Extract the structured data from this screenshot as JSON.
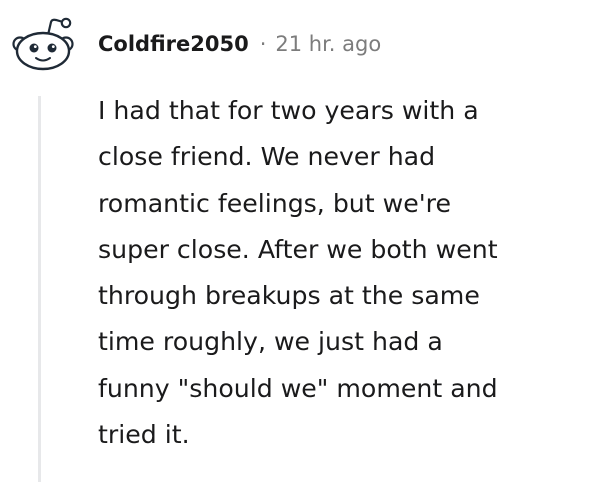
{
  "comment": {
    "author": "Coldfire2050",
    "separator": "·",
    "timestamp": "21 hr. ago",
    "avatar_icon": "reddit-snoo-icon",
    "body": "I had that for two years with a\nclose friend. We never had\nromantic feelings, but we're\nsuper close. After we both went\nthrough breakups at the same\ntime roughly, we just had a\nfunny \"should we\" moment and\ntried it."
  },
  "colors": {
    "text": "#1a1a1b",
    "meta": "#7c7c7c",
    "thread_line": "#e7e8ea",
    "avatar_outline": "#1f2a36"
  }
}
